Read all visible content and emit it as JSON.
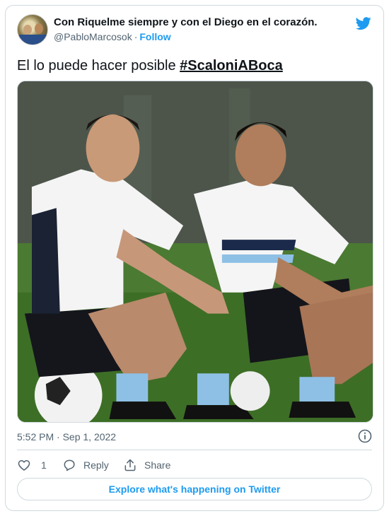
{
  "user": {
    "display_name": "Con Riquelme siempre y con el Diego en el corazón.",
    "handle": "@PabloMarcosok",
    "separator": "·",
    "follow_label": "Follow"
  },
  "tweet": {
    "text": "El lo puede hacer posible ",
    "hashtag": "#ScaloniABoca"
  },
  "meta": {
    "timestamp": "5:52 PM · Sep 1, 2022"
  },
  "actions": {
    "like_count": "1",
    "reply_label": "Reply",
    "share_label": "Share"
  },
  "explore_label": "Explore what's happening on Twitter",
  "icons": {
    "brand": "twitter-bird-icon",
    "info": "info-icon",
    "like": "heart-icon",
    "reply": "reply-bubble-icon",
    "share": "share-upload-icon"
  },
  "colors": {
    "accent": "#1d9bf0",
    "text": "#0f1419",
    "secondary": "#536471",
    "border": "#cfd9de"
  }
}
